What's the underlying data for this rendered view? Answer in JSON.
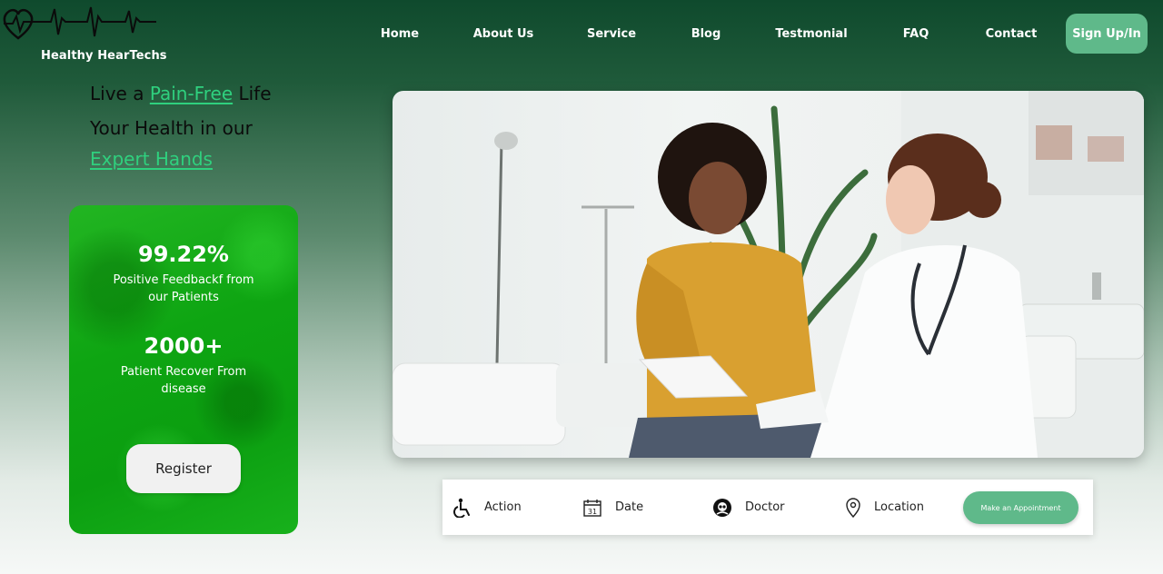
{
  "brand": {
    "name": "Healthy HearTechs",
    "logo_icon": "heart-pulse-icon"
  },
  "nav": {
    "items": [
      "Home",
      "About Us",
      "Service",
      "Blog",
      "Testmonial",
      "FAQ",
      "Contact"
    ],
    "signup_label": "Sign Up/In"
  },
  "hero": {
    "line1_prefix": "Live a ",
    "line1_highlight": "Pain-Free",
    "line1_suffix": " Life",
    "line2": "Your Health in our",
    "line3_highlight": "Expert Hands"
  },
  "stats": {
    "items": [
      {
        "value": "99.22%",
        "label": "Positive Feedbackf from our Patients"
      },
      {
        "value": "2000+",
        "label": "Patient Recover From disease"
      }
    ],
    "register_label": "Register"
  },
  "appointment": {
    "items": [
      {
        "icon": "wheelchair-icon",
        "label": "Action"
      },
      {
        "icon": "calendar-icon",
        "label": "Date"
      },
      {
        "icon": "doctor-icon",
        "label": "Doctor"
      },
      {
        "icon": "location-pin-icon",
        "label": "Location"
      }
    ],
    "calendar_day": "31",
    "button_label": "Make an Appointment"
  },
  "colors": {
    "accent": "#5fb98a",
    "highlight": "#2fd07e",
    "card_green": "#0ea512",
    "header_dark": "#0f4a2d"
  }
}
